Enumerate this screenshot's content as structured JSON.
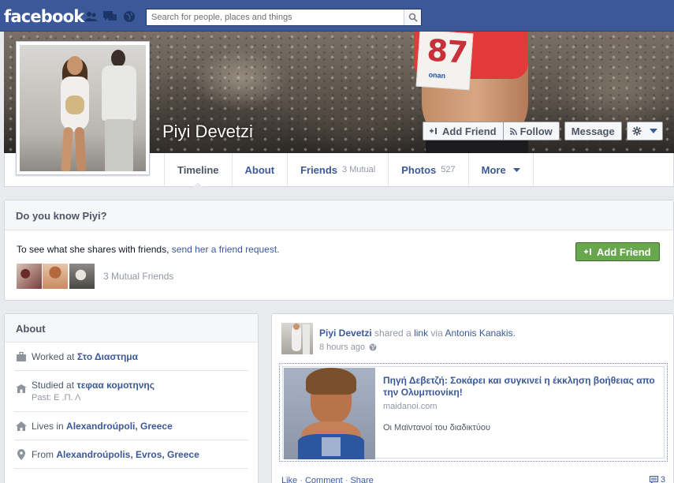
{
  "header": {
    "logo": "facebook",
    "search_placeholder": "Search for people, places and things"
  },
  "profile": {
    "name": "Piyi Devetzi",
    "cover_bib": {
      "number": "87",
      "brand": "onan"
    },
    "actions": {
      "add_friend": "Add Friend",
      "follow": "Follow",
      "message": "Message"
    }
  },
  "tabs": [
    {
      "label": "Timeline",
      "count": ""
    },
    {
      "label": "About",
      "count": ""
    },
    {
      "label": "Friends",
      "count": "3 Mutual"
    },
    {
      "label": "Photos",
      "count": "527"
    },
    {
      "label": "More",
      "count": ""
    }
  ],
  "know_box": {
    "title": "Do you know Piyi?",
    "text": "To see what she shares with friends, ",
    "link": "send her a friend request.",
    "button": "Add Friend",
    "mutual_text": "3 Mutual Friends"
  },
  "about": {
    "title": "About",
    "items": [
      {
        "icon": "briefcase-icon",
        "prefix": "Worked at ",
        "value": "Στο Διαστημα",
        "sub": ""
      },
      {
        "icon": "school-icon",
        "prefix": "Studied at ",
        "value": "τεφαα κομοτηνης",
        "sub": "Past: Ε .Π. Λ"
      },
      {
        "icon": "home-icon",
        "prefix": "Lives in ",
        "value": "Alexandroúpoli, Greece",
        "sub": ""
      },
      {
        "icon": "location-pin-icon",
        "prefix": "From ",
        "value": "Alexandroúpolis, Evros, Greece",
        "sub": ""
      }
    ]
  },
  "post": {
    "author": "Piyi Devetzi",
    "action_text": " shared a ",
    "link_word": "link",
    "via_text": " via ",
    "via_name": "Antonis Kanakis.",
    "time": "8 hours ago",
    "shared": {
      "title": "Πηγή Δεβετζή: Σοκάρει και συγκινεί η έκκληση βοήθειας απο την Ολυμπιονίκη!",
      "domain": "maidanoi.com",
      "description": "Οι Μαϊντανοί του διαδικτύου"
    },
    "actions": {
      "like": "Like",
      "comment": "Comment",
      "share": "Share"
    },
    "comment_count": "3"
  }
}
